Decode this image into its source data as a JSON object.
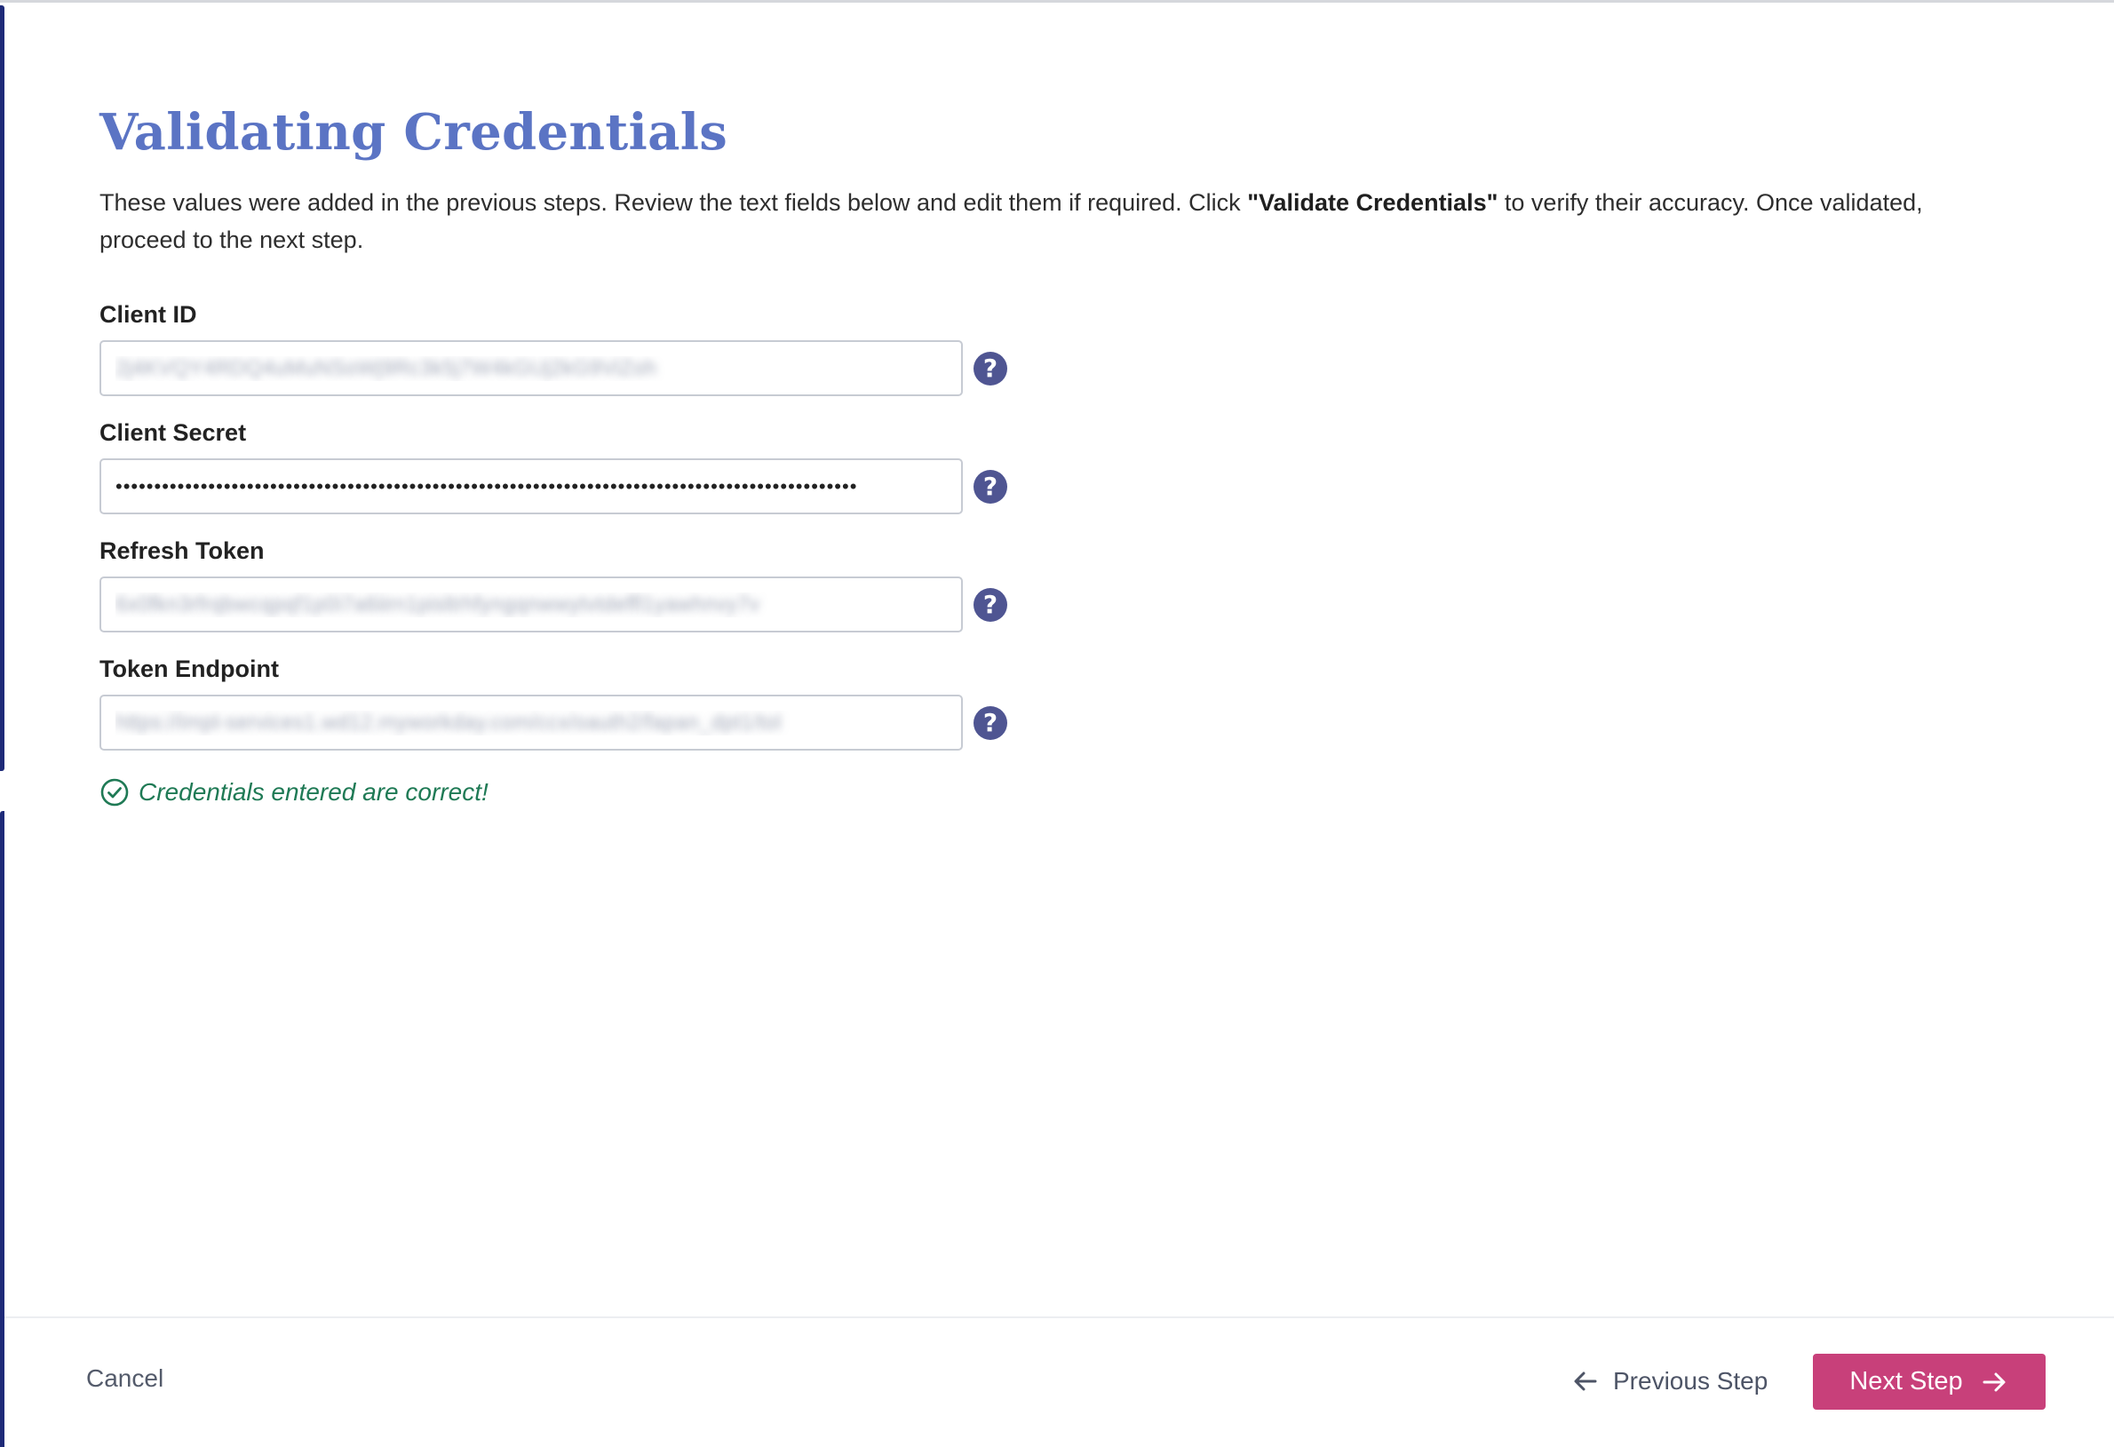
{
  "page": {
    "title": "Validating Credentials",
    "description_before": "These values were added in the previous steps. Review the text fields below and edit them if required. Click ",
    "description_bold": "\"Validate Credentials\"",
    "description_after": " to verify their accuracy. Once validated, proceed to the next step."
  },
  "fields": [
    {
      "label": "Client ID",
      "value": "2j4KVQY4RDQ4uMuNSoWj9Rc3k5j7W4kGUj2kG9ViZoh"
    },
    {
      "label": "Client Secret",
      "value": "••••••••••••••••••••••••••••••••••••••••••••••••••••••••••••••••••••••••••••••••••••••••••••••••"
    },
    {
      "label": "Refresh Token",
      "value": "6x0fkn3rfrqbwcqpqf1p0i7a6iirn1pisltrhfyngqnwwytvtdeffl1yawhnvy7v"
    },
    {
      "label": "Token Endpoint",
      "value": "https://impl-services1.wd12.myworkday.com/ccx/oauth2/fapan_dpt1/tol"
    }
  ],
  "status": {
    "message": "Credentials entered are correct!",
    "color": "#1f7a55"
  },
  "footer": {
    "cancel_label": "Cancel",
    "previous_label": "Previous Step",
    "next_label": "Next Step"
  },
  "colors": {
    "title": "#5b74c4",
    "primary_button": "#c8407a",
    "help_icon": "#4f5592",
    "left_accent": "#1e2a78"
  },
  "icons": {
    "help": "question-mark-icon",
    "success": "check-circle-icon",
    "previous": "arrow-left-icon",
    "next": "arrow-right-icon"
  }
}
